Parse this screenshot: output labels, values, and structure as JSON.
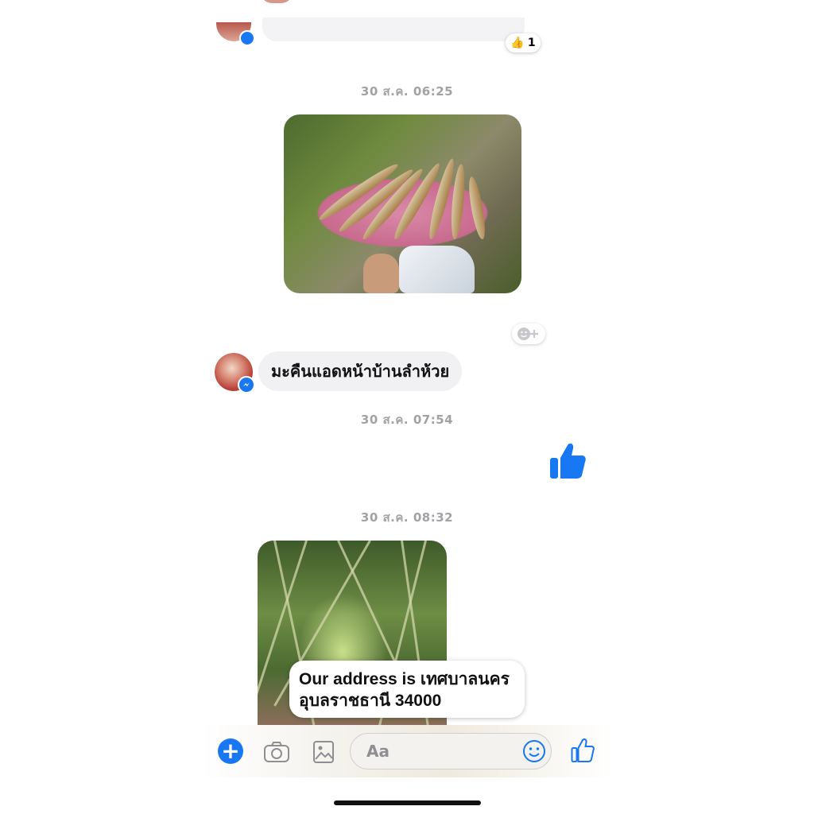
{
  "previous": {
    "reaction_emoji": "👍",
    "reaction_count": "1"
  },
  "timestamps": {
    "t1": "30 ส.ค. 06:25",
    "t2": "30 ส.ค. 07:54",
    "t3": "30 ส.ค. 08:32"
  },
  "messages": {
    "incoming_text": "มะคืนแอดหน้าบ้านลำห้วย"
  },
  "overlay": {
    "line1": "Our address is เทศบาลนคร",
    "line2": "อุบลราชธานี 34000"
  },
  "composer": {
    "placeholder": "Aa"
  },
  "colors": {
    "accent": "#1877f2",
    "bubble": "#f1f1f3",
    "timestamp": "#a2a2a6"
  },
  "icons": [
    "plus-icon",
    "camera-icon",
    "photo-icon",
    "emoji-icon",
    "thumbs-up-icon",
    "add-reaction-icon",
    "messenger-icon"
  ]
}
